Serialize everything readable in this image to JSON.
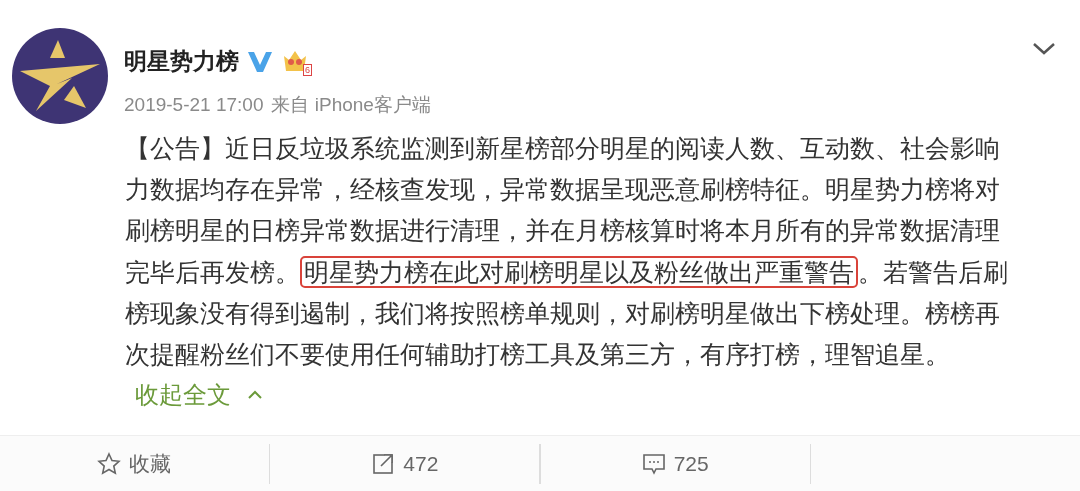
{
  "post": {
    "author": "明星势力榜",
    "verified": true,
    "member_level": "6",
    "time": "2019-5-21 17:00",
    "source": "来自 iPhone客户端",
    "body": [
      {
        "kind": "text",
        "text": "【公告】近日反垃圾系统监测到新星榜部分明星的阅读人数、互动数、社会影响力数据均存在异常，经核查发现，异常数据呈现恶意刷榜特征。明星势力榜将对刷榜明星的日榜异常数据进行清理，并在月榜核算时将本月所有的异常数据清理完毕后再发榜。"
      },
      {
        "kind": "highlight",
        "text": "明星势力榜在此对刷榜明星以及粉丝做出严重警告"
      },
      {
        "kind": "text",
        "text": "。若警告后刷榜现象没有得到遏制，我们将按照榜单规则，对刷榜明星做出下榜处理。榜榜再次提醒粉丝们不要使用任何辅助打榜工具及第三方，有序打榜，理智追星。"
      }
    ],
    "collapse_label": "收起全文"
  },
  "actions": [
    {
      "kind": "favorite",
      "label": "收藏"
    },
    {
      "kind": "repost",
      "label": "472"
    },
    {
      "kind": "comment",
      "label": "725"
    },
    {
      "kind": "hidden"
    }
  ]
}
